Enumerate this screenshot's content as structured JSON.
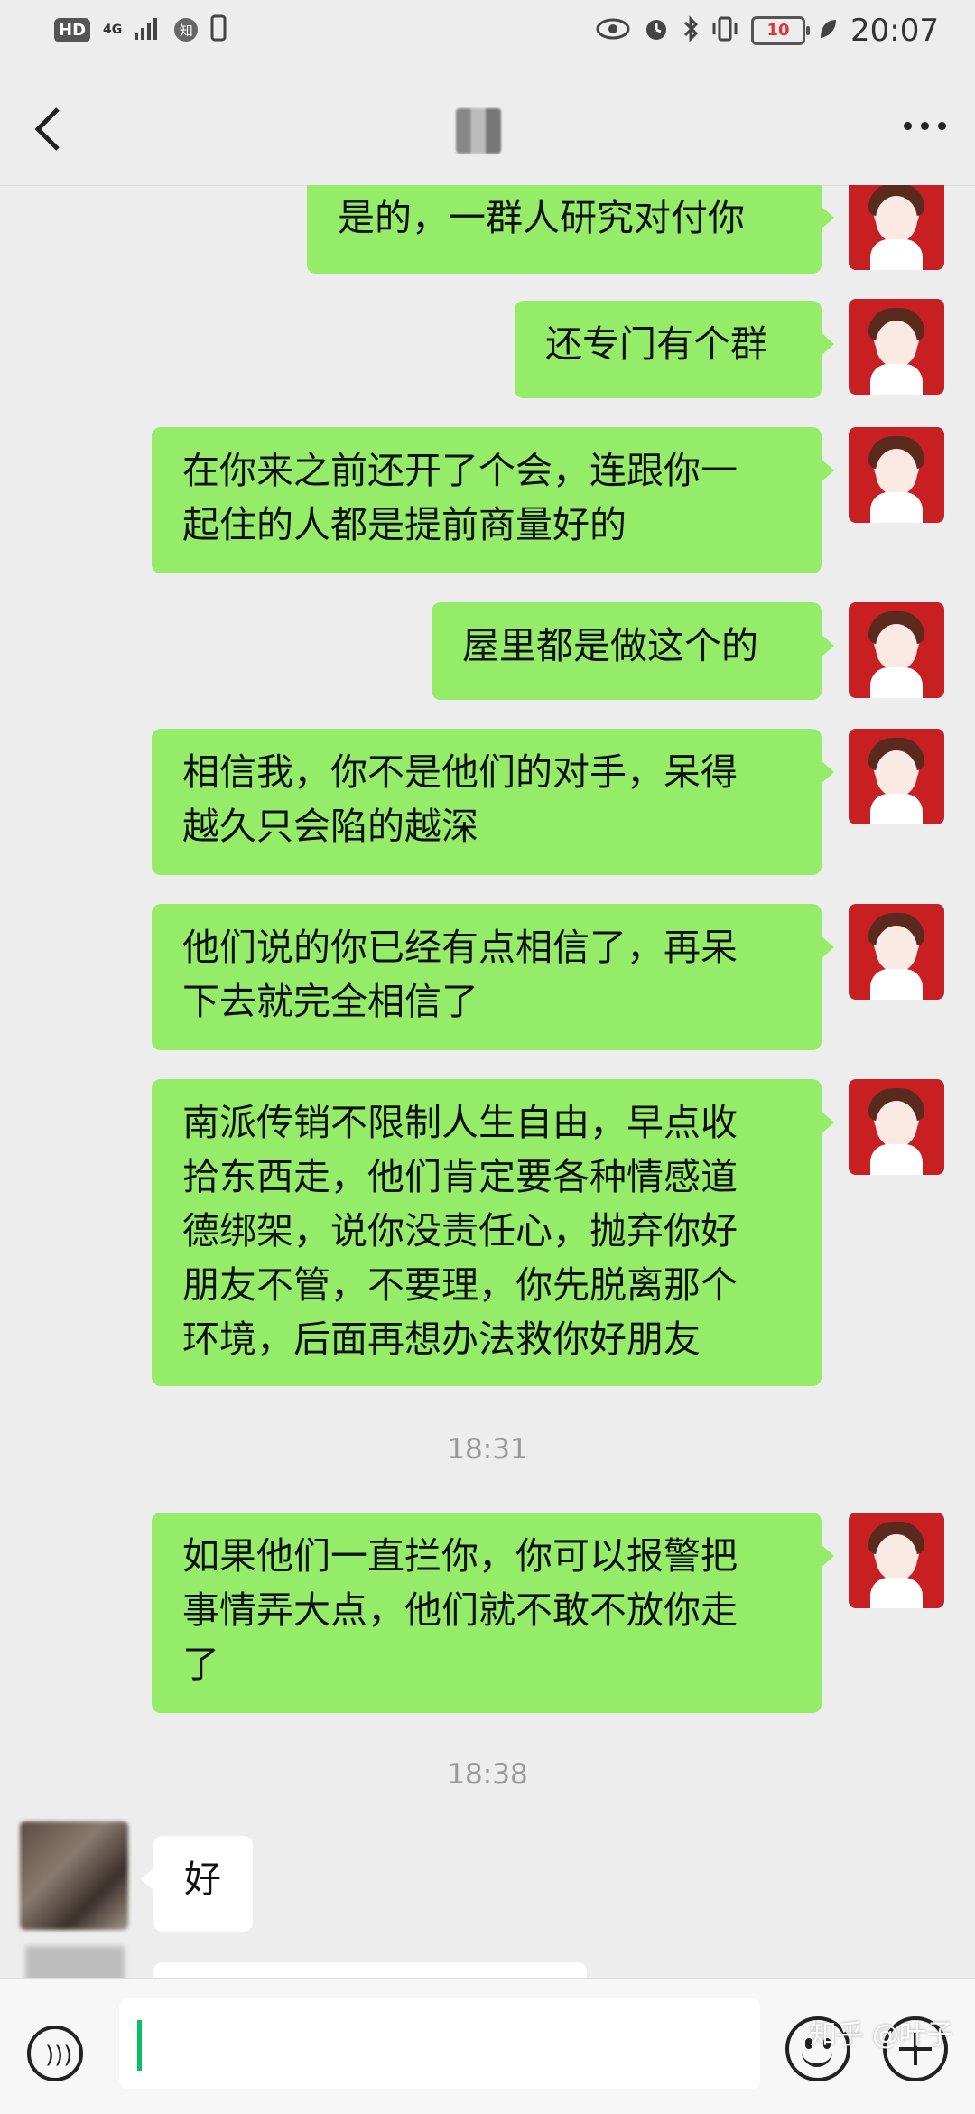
{
  "status_bar": {
    "hd": "HD",
    "network": "4G",
    "app_badge": "知",
    "battery": "10",
    "time": "20:07"
  },
  "nav": {
    "back_icon": "chevron-left-icon",
    "more_icon": "more-dots-icon"
  },
  "messages": [
    {
      "side": "out",
      "text": "是的，一群人研究对付你"
    },
    {
      "side": "out",
      "text": "还专门有个群"
    },
    {
      "side": "out",
      "text": "在你来之前还开了个会，连跟你一\n起住的人都是提前商量好的"
    },
    {
      "side": "out",
      "text": "屋里都是做这个的"
    },
    {
      "side": "out",
      "text": "相信我，你不是他们的对手，呆得\n越久只会陷的越深"
    },
    {
      "side": "out",
      "text": "他们说的你已经有点相信了，再呆\n下去就完全相信了"
    },
    {
      "side": "out",
      "text": "南派传销不限制人生自由，早点收\n拾东西走，他们肯定要各种情感道\n德绑架，说你没责任心，抛弃你好\n朋友不管，不要理，你先脱离那个\n环境，后面再想办法救你好朋友"
    },
    {
      "time": "18:31"
    },
    {
      "side": "out",
      "text": "如果他们一直拦你，你可以报警把\n事情弄大点，他们就不敢不放你走\n了"
    },
    {
      "time": "18:38"
    },
    {
      "side": "in",
      "text": "好"
    }
  ],
  "timestamps": [
    "18:31",
    "18:38"
  ],
  "input_bar": {
    "voice_icon": "voice-icon",
    "emoji_icon": "emoji-icon",
    "plus_icon": "plus-icon"
  },
  "watermark": "知乎 @叶子",
  "colors": {
    "bubble_out": "#95ec69",
    "bubble_in": "#ffffff",
    "background": "#ededed",
    "accent": "#07c160"
  }
}
